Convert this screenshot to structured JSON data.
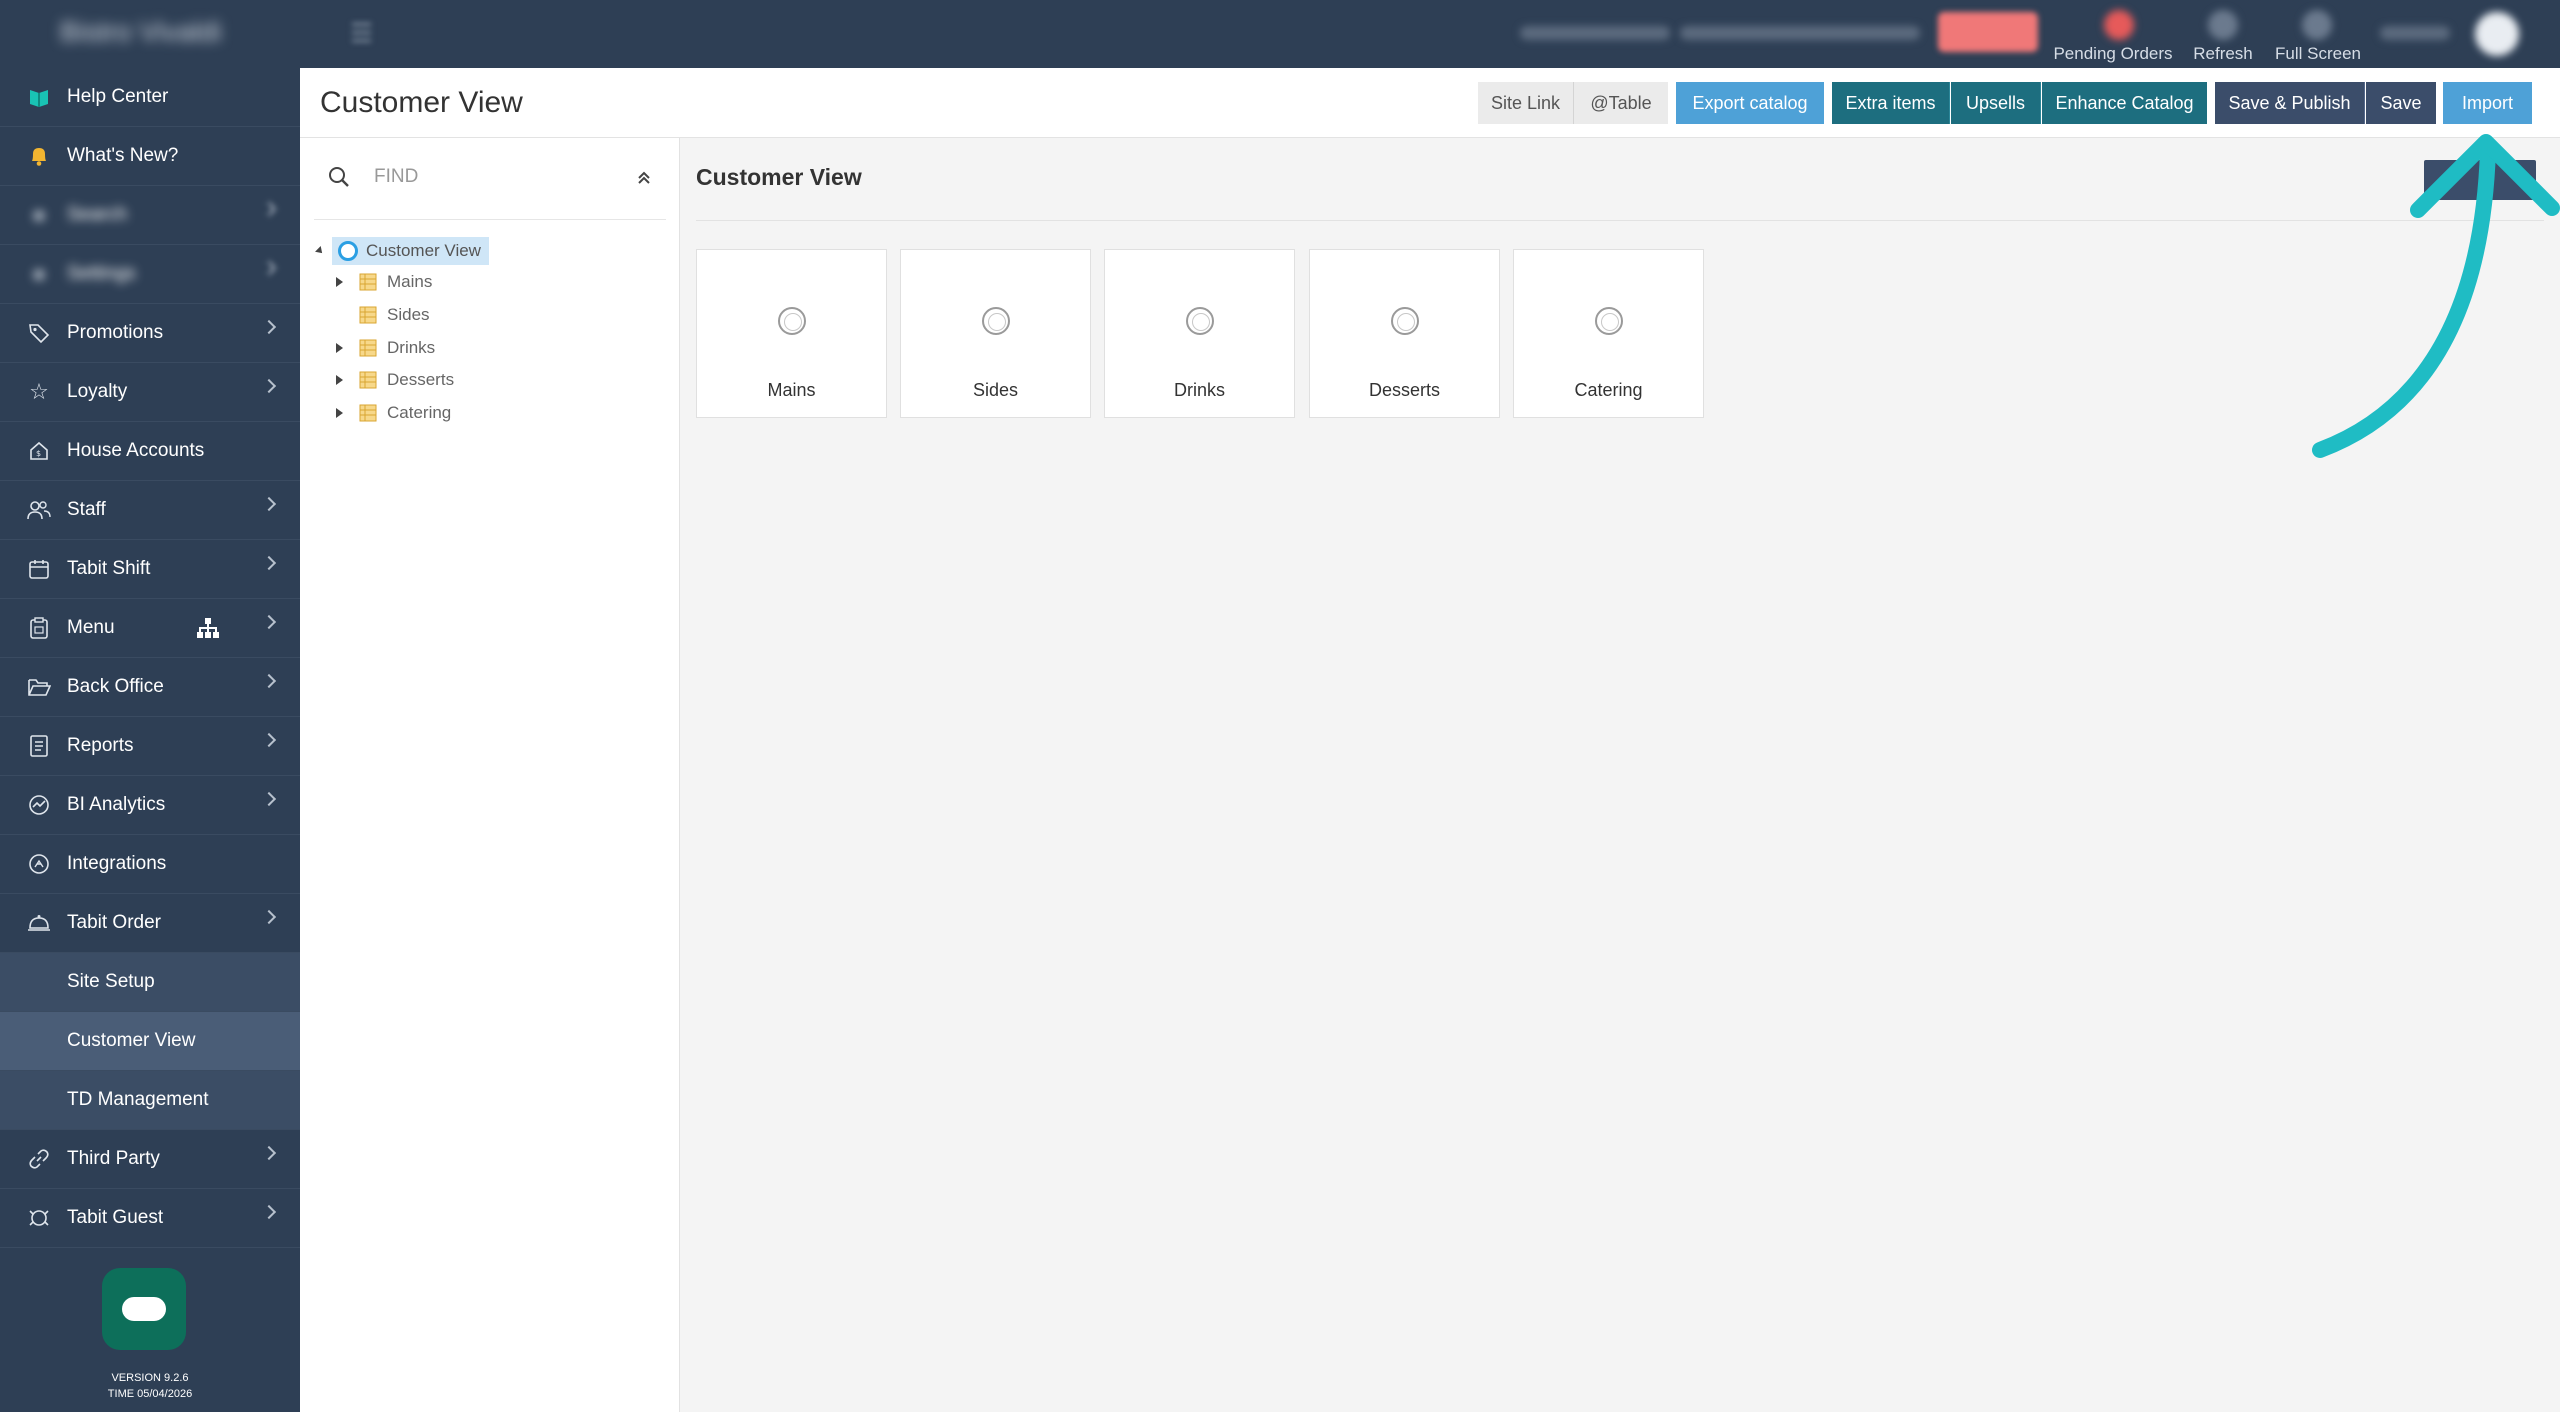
{
  "topbar": {
    "brand": "Bistro Vivaldi",
    "labels": {
      "pending_orders": "Pending Orders",
      "refresh": "Refresh",
      "full_screen": "Full Screen"
    }
  },
  "sidebar": {
    "items": [
      {
        "label": "Help Center",
        "icon": "book-icon"
      },
      {
        "label": "What's New?",
        "icon": "bell-icon"
      },
      {
        "label": "Search",
        "icon": "blurred-icon"
      },
      {
        "label": "Settings",
        "icon": "blurred-icon"
      },
      {
        "label": "Promotions",
        "icon": "tag-icon"
      },
      {
        "label": "Loyalty",
        "icon": "star-icon"
      },
      {
        "label": "House Accounts",
        "icon": "house-icon"
      },
      {
        "label": "Staff",
        "icon": "users-icon"
      },
      {
        "label": "Tabit Shift",
        "icon": "calendar-icon"
      },
      {
        "label": "Menu",
        "icon": "clipboard-icon"
      },
      {
        "label": "Back Office",
        "icon": "folder-icon"
      },
      {
        "label": "Reports",
        "icon": "document-icon"
      },
      {
        "label": "BI Analytics",
        "icon": "analytics-icon"
      },
      {
        "label": "Integrations",
        "icon": "integrations-icon"
      },
      {
        "label": "Tabit Order",
        "icon": "cloche-icon"
      },
      {
        "label": "Site Setup"
      },
      {
        "label": "Customer View"
      },
      {
        "label": "TD Management"
      },
      {
        "label": "Third Party",
        "icon": "link-icon"
      },
      {
        "label": "Tabit Guest",
        "icon": "guest-icon"
      }
    ],
    "version": "VERSION 9.2.6",
    "time": "TIME 05/04/2026"
  },
  "header": {
    "title": "Customer View",
    "buttons": {
      "site_link": "Site Link",
      "table": "@Table",
      "export_catalog": "Export catalog",
      "extra_items": "Extra items",
      "upsells": "Upsells",
      "enhance_catalog": "Enhance Catalog",
      "save_publish": "Save & Publish",
      "save": "Save",
      "import": "Import"
    }
  },
  "tree": {
    "find_placeholder": "FIND",
    "root": "Customer View",
    "nodes": [
      "Mains",
      "Sides",
      "Drinks",
      "Desserts",
      "Catering"
    ]
  },
  "content": {
    "title": "Customer View",
    "cards": [
      "Mains",
      "Sides",
      "Drinks",
      "Desserts",
      "Catering"
    ]
  },
  "colors": {
    "sidebar": "#2e3f55",
    "teal_button": "#1d6e7f",
    "blue_button": "#4ea1d7",
    "arrow": "#1fbcc4"
  }
}
